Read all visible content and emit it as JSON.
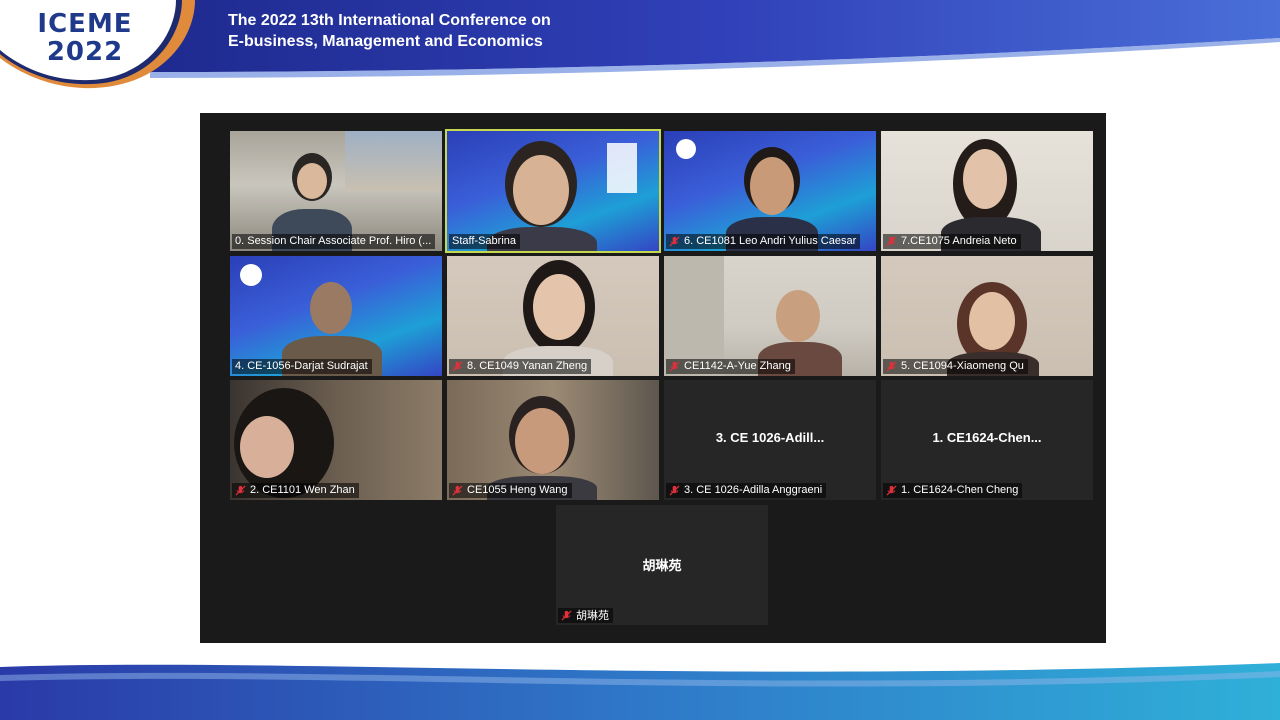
{
  "header": {
    "logo_line1": "ICEME",
    "logo_line2": "2022",
    "title_line1": "The 2022 13th International Conference on",
    "title_line2": "E-business, Management and Economics"
  },
  "colors": {
    "banner_blue": "#2a3aa8",
    "banner_orange": "#e08a3c",
    "active_speaker_border": "#c6d94e",
    "gallery_bg": "#1a1a1a",
    "muted_mic": "#e0313a"
  },
  "participants": [
    {
      "label": "0. Session Chair Associate Prof. Hiro (...",
      "muted": false,
      "video": true
    },
    {
      "label": "Staff-Sabrina",
      "muted": false,
      "video": true,
      "active_speaker": true
    },
    {
      "label": "6. CE1081 Leo Andri Yulius Caesar",
      "muted": true,
      "video": true
    },
    {
      "label": "7.CE1075 Andreia Neto",
      "muted": true,
      "video": true
    },
    {
      "label": "4. CE-1056-Darjat Sudrajat",
      "muted": false,
      "video": true
    },
    {
      "label": "8. CE1049 Yanan Zheng",
      "muted": true,
      "video": true
    },
    {
      "label": "CE1142-A-Yue Zhang",
      "muted": true,
      "video": true
    },
    {
      "label": "5. CE1094-Xiaomeng Qu",
      "muted": true,
      "video": true
    },
    {
      "label": "2. CE1101 Wen Zhan",
      "muted": true,
      "video": true
    },
    {
      "label": "CE1055 Heng Wang",
      "muted": true,
      "video": true
    },
    {
      "label": "3. CE 1026-Adilla Anggraeni",
      "center_name": "3. CE 1026-Adill...",
      "muted": true,
      "video": false
    },
    {
      "label": "1. CE1624-Chen Cheng",
      "center_name": "1. CE1624-Chen...",
      "muted": true,
      "video": false
    },
    {
      "label": "胡琳苑",
      "center_name": "胡琳苑",
      "muted": true,
      "video": false
    }
  ]
}
